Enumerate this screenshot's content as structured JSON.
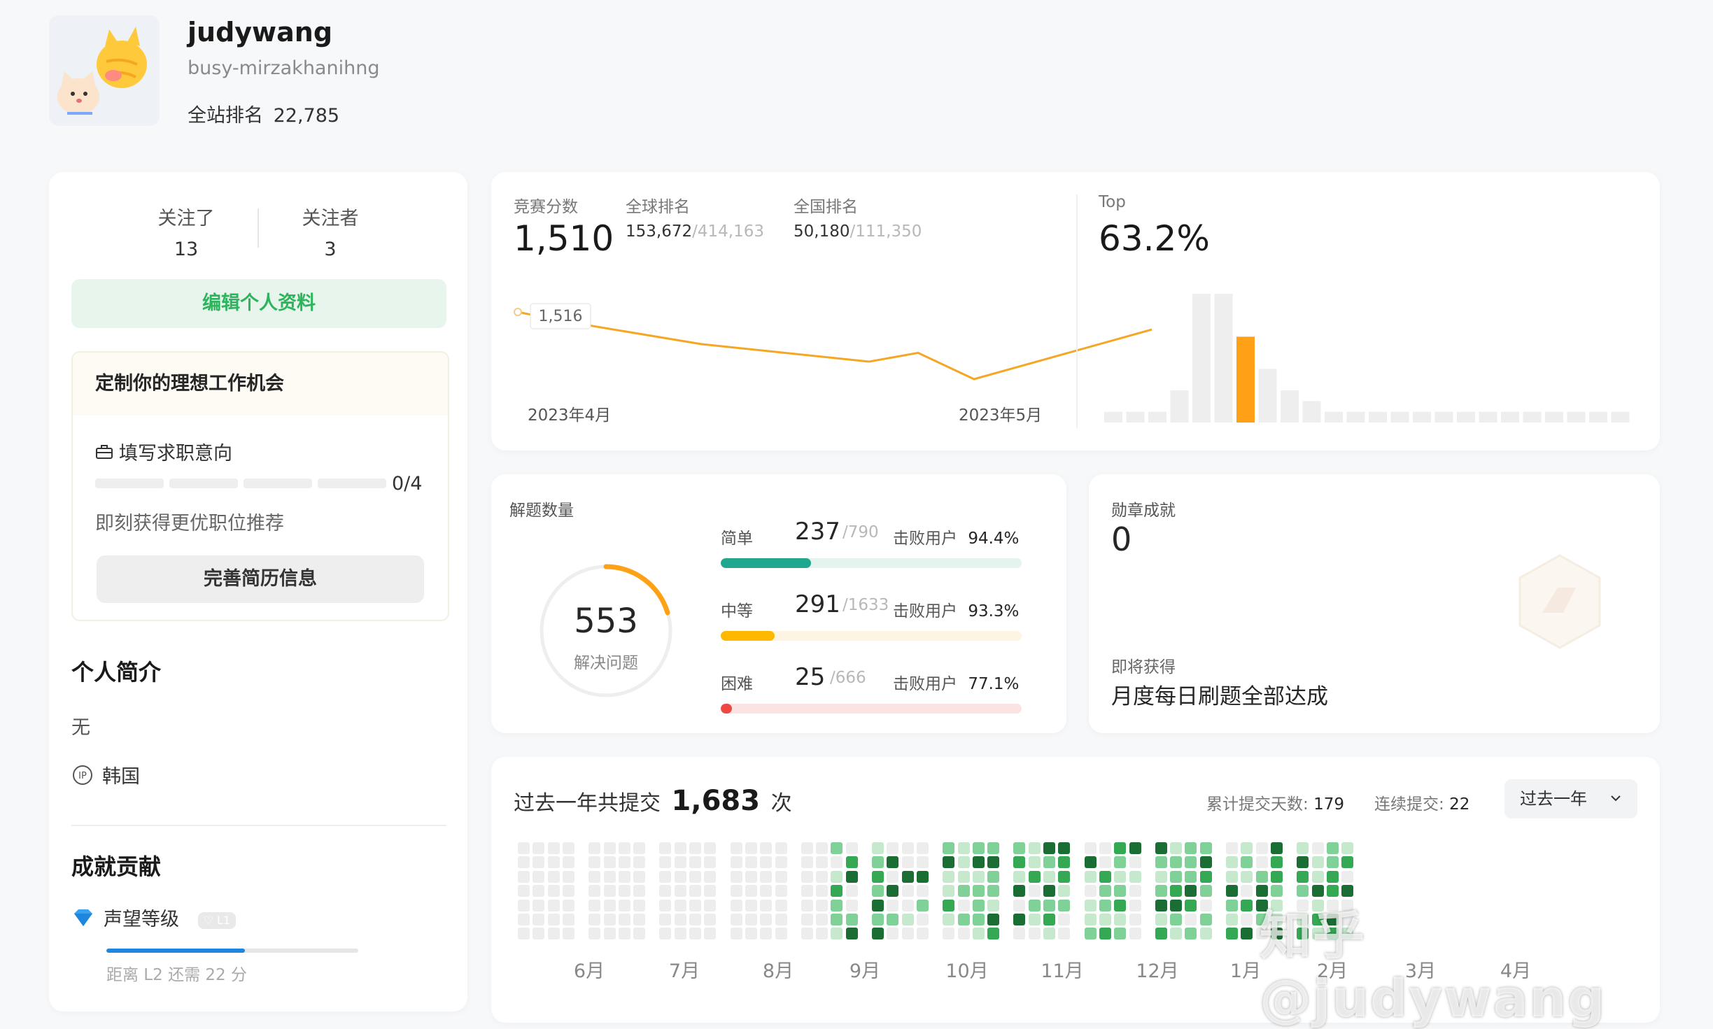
{
  "profile": {
    "name": "judywang",
    "slug": "busy-mirzakhanihng",
    "rank_label": "全站排名",
    "rank_value": "22,785"
  },
  "left": {
    "following_label": "关注了",
    "following_count": "13",
    "followers_label": "关注者",
    "followers_count": "3",
    "edit_profile": "编辑个人资料",
    "job_title": "定制你的理想工作机会",
    "job_fill": "填写求职意向",
    "job_progress": "0/4",
    "job_hint": "即刻获得更优职位推荐",
    "resume_button": "完善简历信息",
    "intro_title": "个人简介",
    "intro_text": "无",
    "location": "韩国",
    "contrib_title": "成就贡献",
    "reputation_label": "声望等级",
    "reputation_badge": "L1",
    "reputation_progress": 0.55,
    "reputation_hint": "距离 L2 还需 22 分"
  },
  "rating": {
    "score_label": "竞赛分数",
    "score": "1,510",
    "global_label": "全球排名",
    "global_rank": "153,672",
    "global_total": "/414,163",
    "national_label": "全国排名",
    "national_rank": "50,180",
    "national_total": "/111,350",
    "top_label": "Top",
    "top_value": "63.2%",
    "tooltip": "1,516",
    "x_start": "2023年4月",
    "x_end": "2023年5月",
    "line_color": "#f5a623"
  },
  "solved": {
    "title": "解题数量",
    "total": "553",
    "total_label": "解决问题",
    "easy_label": "简单",
    "easy_count": "237",
    "easy_total": "/790",
    "easy_beat": "94.4%",
    "medium_label": "中等",
    "medium_count": "291",
    "medium_total": "/1633",
    "medium_beat": "93.3%",
    "hard_label": "困难",
    "hard_count": "25",
    "hard_total": "/666",
    "hard_beat": "77.1%",
    "beat_label": "击败用户",
    "easy_color": "#1fa88e",
    "medium_color": "#ffb800",
    "hard_color": "#ef4743"
  },
  "badges": {
    "title": "勋章成就",
    "count": "0",
    "upcoming_label": "即将获得",
    "upcoming": "月度每日刷题全部达成"
  },
  "submissions": {
    "title_prefix": "过去一年共提交",
    "total": "1,683",
    "title_suffix": "次",
    "days_label": "累计提交天数:",
    "days": "179",
    "streak_label": "连续提交:",
    "streak": "22",
    "range": "过去一年",
    "months": [
      "6月",
      "7月",
      "8月",
      "9月",
      "10月",
      "11月",
      "12月",
      "1月",
      "2月",
      "3月",
      "4月"
    ]
  },
  "watermark": "知乎 @judywang",
  "chart_data": [
    {
      "type": "line",
      "x": [
        "2023年4月",
        "",
        "",
        "",
        "",
        "",
        "2023年5月"
      ],
      "values": [
        1516,
        1513,
        1505,
        1499,
        1502,
        1493,
        1510
      ],
      "xlabel": "",
      "ylabel": ""
    },
    {
      "type": "bar",
      "values": [
        1,
        1,
        1,
        3,
        12,
        12,
        8,
        5,
        3,
        2,
        1,
        1,
        1,
        1,
        1,
        1,
        1,
        1,
        1,
        1,
        1,
        1,
        1,
        1
      ],
      "highlight_index": 6,
      "highlight_color": "#ffa116"
    }
  ]
}
